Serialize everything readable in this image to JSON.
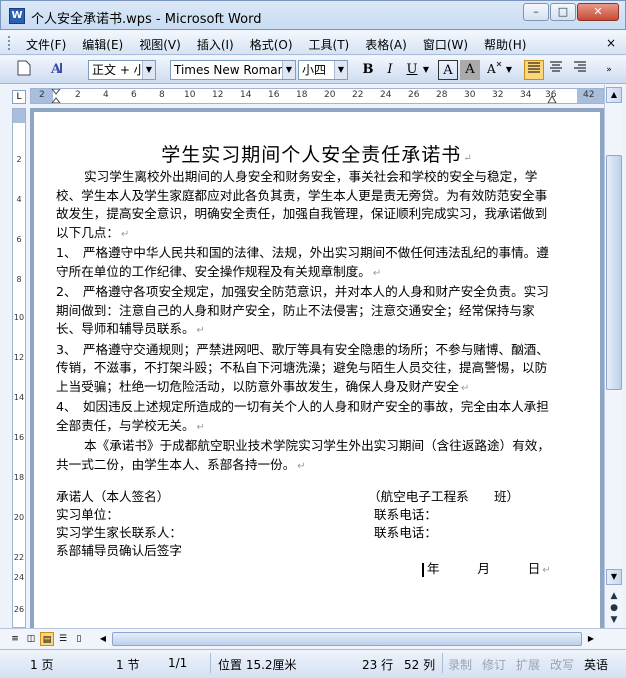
{
  "window": {
    "title": "个人安全承诺书.wps - Microsoft Word",
    "app_icon": "W",
    "minimize": "–",
    "maximize": "□",
    "close": "✕"
  },
  "menu": {
    "items": [
      "文件(F)",
      "编辑(E)",
      "视图(V)",
      "插入(I)",
      "格式(O)",
      "工具(T)",
      "表格(A)",
      "窗口(W)",
      "帮助(H)"
    ],
    "doc_close": "×"
  },
  "toolbar": {
    "style_value": "正文 + 小四",
    "font_value": "Times New Roman",
    "size_value": "小四",
    "bold": "B",
    "italic": "I",
    "underline": "U",
    "char_border": "A",
    "char_shading": "A",
    "char_scale": "A"
  },
  "ruler": {
    "ticks": [
      "2",
      "2",
      "4",
      "6",
      "8",
      "10",
      "12",
      "14",
      "16",
      "18",
      "20",
      "22",
      "24",
      "26",
      "28",
      "30",
      "32",
      "34",
      "36",
      "38",
      "42"
    ],
    "vticks": [
      "2",
      "4",
      "6",
      "8",
      "10",
      "12",
      "14",
      "16",
      "18",
      "20",
      "22",
      "24",
      "26"
    ]
  },
  "document": {
    "title": "学生实习期间个人安全责任承诺书",
    "paragraphs": [
      "实习学生离校外出期间的人身安全和财务安全，事关社会和学校的安全与稳定，学校、学生本人及学生家庭都应对此各负其责，学生本人更是责无旁贷。为有效防范安全事故发生，提高安全意识，明确安全责任，加强自我管理，保证顺利完成实习，我承诺做到以下几点：",
      "1、　严格遵守中华人民共和国的法律、法规，外出实习期间不做任何违法乱纪的事情。遵守所在单位的工作纪律、安全操作规程及有关规章制度。",
      "2、　严格遵守各项安全规定，加强安全防范意识，并对本人的人身和财产安全负责。实习期间做到：注意自己的人身和财产安全，防止不法侵害；注意交通安全；经常保持与家长、导师和辅导员联系。",
      "3、　严格遵守交通规则；严禁进网吧、歌厅等具有安全隐患的场所；不参与赌博、酗酒、传销，不滋事，不打架斗殴；不私自下河塘洗澡；避免与陌生人员交往，提高警惕，以防上当受骗；杜绝一切危险活动，以防意外事故发生，确保人身及财产安全",
      "4、　如因违反上述规定所造成的一切有关个人的人身和财产安全的事故，完全由本人承担全部责任，与学校无关。",
      "本《承诺书》于成都航空职业技术学院实习学生外出实习期间（含往返路途）有效，共一式二份，由学生本人、系部各持一份。"
    ],
    "signatures": {
      "student": "承诺人（本人签名）",
      "class": "（航空电子工程系　　班）",
      "unit": "实习单位：",
      "phone1": "联系电话：",
      "parent": "实习学生家长联系人：",
      "phone2": "联系电话：",
      "counselor": "系部辅导员确认后签字",
      "date": "年　　　月　　　日"
    },
    "para_mark": "↵"
  },
  "statusbar": {
    "page": "1 页",
    "section": "1 节",
    "page_of": "1/1",
    "position": "位置 15.2厘米",
    "line": "23 行",
    "column": "52 列",
    "rec": "录制",
    "trk": "修订",
    "ext": "扩展",
    "ovr": "改写",
    "lang": "英语"
  }
}
